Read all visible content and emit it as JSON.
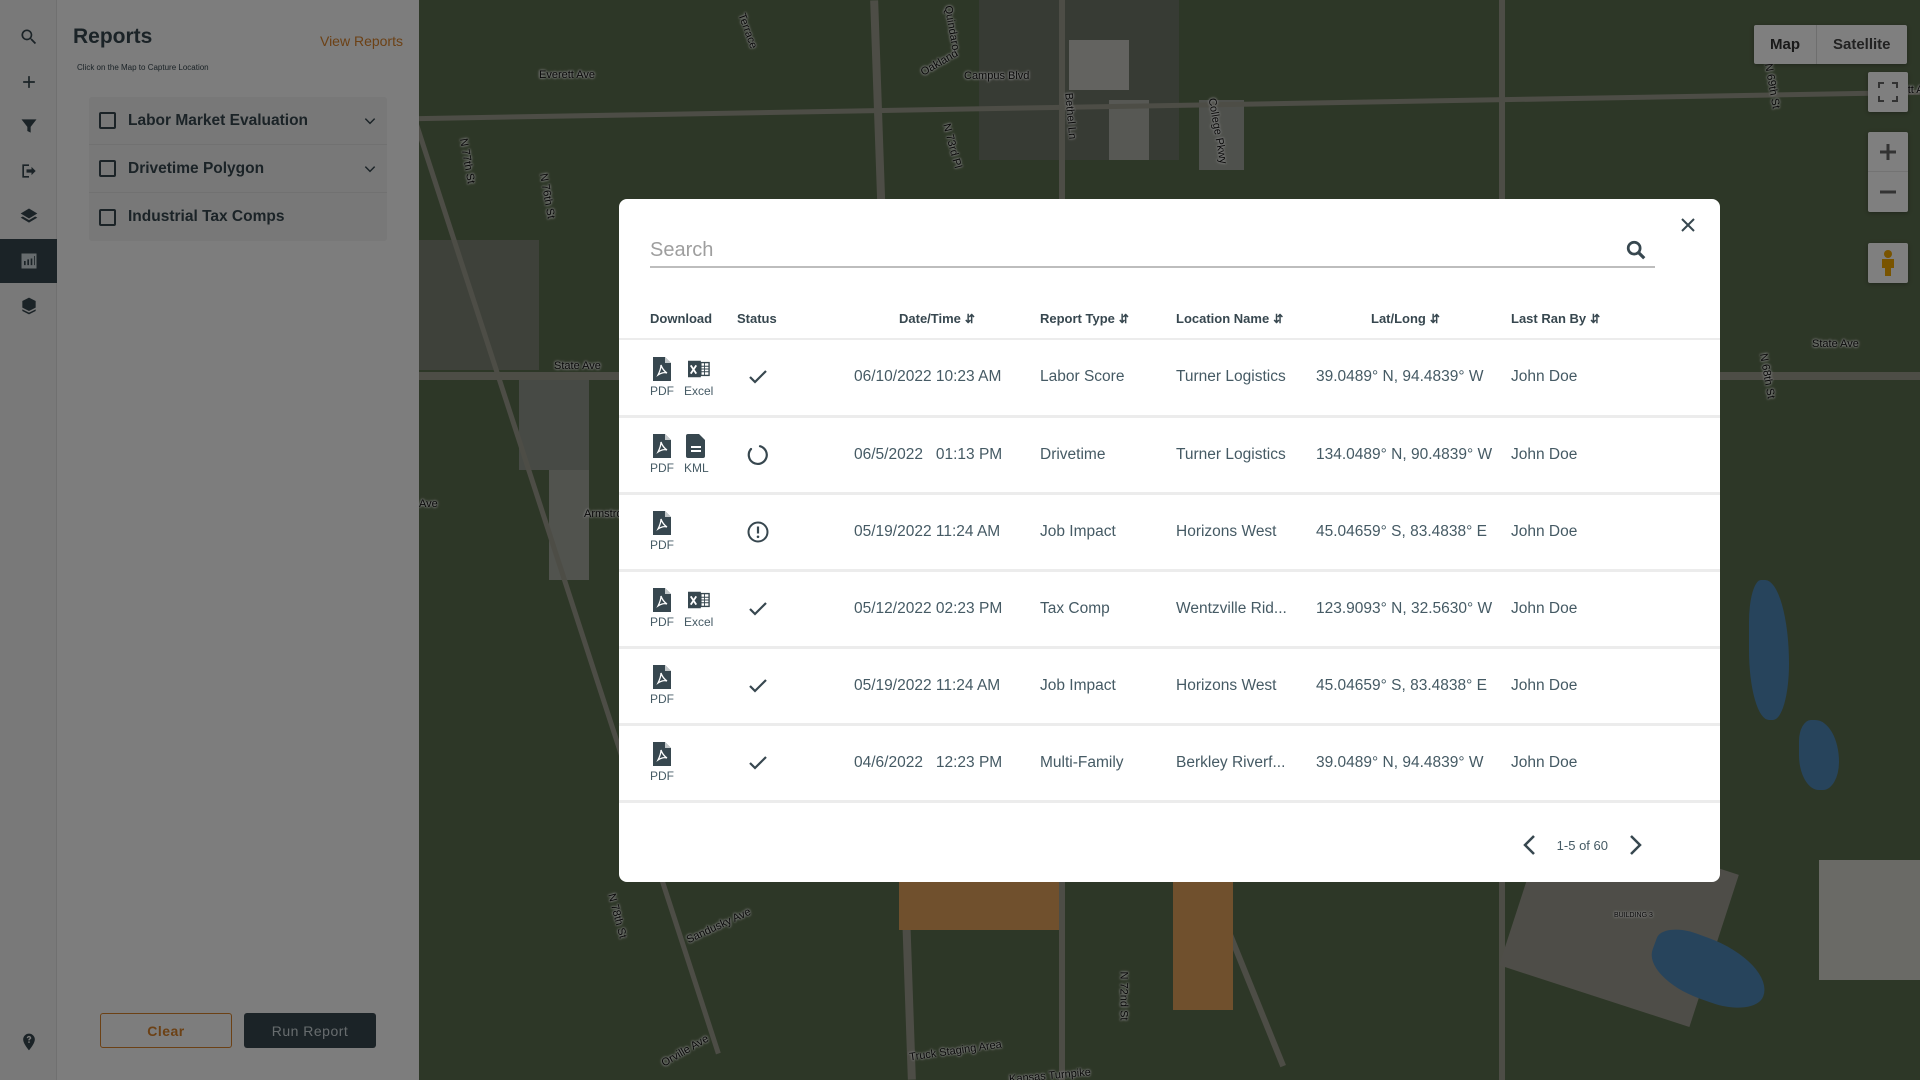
{
  "sidebar": {
    "items": [
      {
        "name": "search",
        "active": false
      },
      {
        "name": "add",
        "active": false
      },
      {
        "name": "filter",
        "active": false
      },
      {
        "name": "export",
        "active": false
      },
      {
        "name": "layers",
        "active": false
      },
      {
        "name": "reports",
        "active": true
      },
      {
        "name": "3d-layers",
        "active": false
      }
    ],
    "help": "help-pin"
  },
  "panel": {
    "title": "Reports",
    "view_reports": "View Reports",
    "hint": "Click on the Map to Capture Location",
    "reports": [
      {
        "label": "Labor Market Evaluation",
        "checked": false,
        "expandable": true
      },
      {
        "label": "Drivetime Polygon",
        "checked": false,
        "expandable": true
      },
      {
        "label": "Industrial Tax Comps",
        "checked": false,
        "expandable": false
      }
    ],
    "clear_label": "Clear",
    "run_label": "Run Report"
  },
  "map": {
    "type_buttons": [
      "Map",
      "Satellite"
    ],
    "active_type": "Satellite",
    "labels": [
      "Oakland",
      "Everett Ave",
      "Everett Ave",
      "Campus Blvd",
      "Quindaro",
      "N 73rd Pl",
      "Bethel Ln",
      "College Pkwy",
      "N 77th St",
      "N 76th St",
      "Terrace",
      "State Ave",
      "State Ave",
      "Armstrong",
      "Sandusky Ave",
      "Orville Ave",
      "N 78th St",
      "N 72nd St",
      "N 69th St",
      "N 68th St",
      "Truck Staging Area",
      "Kansas Turnpike",
      "BUILDING 3",
      "Ave"
    ]
  },
  "modal": {
    "search_placeholder": "Search",
    "search_value": "",
    "columns": [
      {
        "label": "Download",
        "sortable": false
      },
      {
        "label": "Status",
        "sortable": false
      },
      {
        "label": "Date/Time",
        "sortable": true
      },
      {
        "label": "Report Type",
        "sortable": true
      },
      {
        "label": "Location Name",
        "sortable": true
      },
      {
        "label": "Lat/Long",
        "sortable": true
      },
      {
        "label": "Last Ran By",
        "sortable": true
      }
    ],
    "rows": [
      {
        "downloads": [
          "PDF",
          "Excel"
        ],
        "status": "complete",
        "datetime": "06/10/2022 10:23 AM",
        "report_type": "Labor Score",
        "location": "Turner Logistics",
        "latlong": "39.0489° N, 94.4839° W",
        "ran_by": "John Doe"
      },
      {
        "downloads": [
          "PDF",
          "KML"
        ],
        "status": "in-progress",
        "datetime": "06/5/2022   01:13 PM",
        "report_type": "Drivetime",
        "location": "Turner Logistics",
        "latlong": "134.0489° N, 90.4839° W",
        "ran_by": "John Doe"
      },
      {
        "downloads": [
          "PDF"
        ],
        "status": "error",
        "datetime": "05/19/2022 11:24 AM",
        "report_type": "Job Impact",
        "location": "Horizons West",
        "latlong": "45.04659° S, 83.4838° E",
        "ran_by": "John Doe"
      },
      {
        "downloads": [
          "PDF",
          "Excel"
        ],
        "status": "complete",
        "datetime": "05/12/2022 02:23 PM",
        "report_type": "Tax Comp",
        "location": "Wentzville Rid...",
        "latlong": "123.9093° N, 32.5630° W",
        "ran_by": "John Doe"
      },
      {
        "downloads": [
          "PDF"
        ],
        "status": "complete",
        "datetime": "05/19/2022 11:24 AM",
        "report_type": "Job Impact",
        "location": "Horizons West",
        "latlong": "45.04659° S, 83.4838° E",
        "ran_by": "John Doe"
      },
      {
        "downloads": [
          "PDF"
        ],
        "status": "complete",
        "datetime": "04/6/2022   12:23 PM",
        "report_type": "Multi-Family",
        "location": "Berkley Riverf...",
        "latlong": "39.0489° N, 94.4839° W",
        "ran_by": "John Doe"
      }
    ],
    "pagination": "1-5 of 60"
  },
  "colors": {
    "primary": "#37474f",
    "accent": "#d9822b",
    "overlay": "rgba(0,0,0,0.5)"
  }
}
